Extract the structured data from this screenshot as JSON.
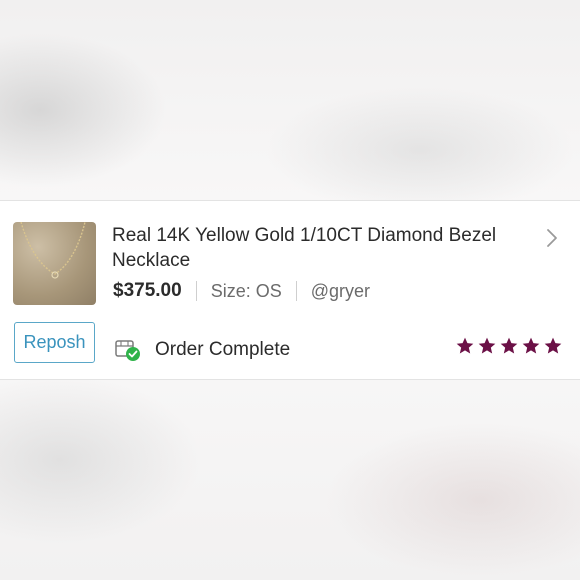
{
  "listing": {
    "title": "Real 14K Yellow Gold 1/10CT Diamond Bezel Necklace",
    "price": "$375.00",
    "size": "Size: OS",
    "seller": "@gryer",
    "thumbnail_icon": "necklace-photo"
  },
  "actions": {
    "repost_label": "Reposh"
  },
  "order": {
    "status": "Order Complete",
    "status_icon": "package-check-icon"
  },
  "rating": {
    "stars": 5,
    "max": 5,
    "color": "#6b1046"
  },
  "colors": {
    "accent_blue": "#3a93bd",
    "status_green": "#2fb34a"
  }
}
